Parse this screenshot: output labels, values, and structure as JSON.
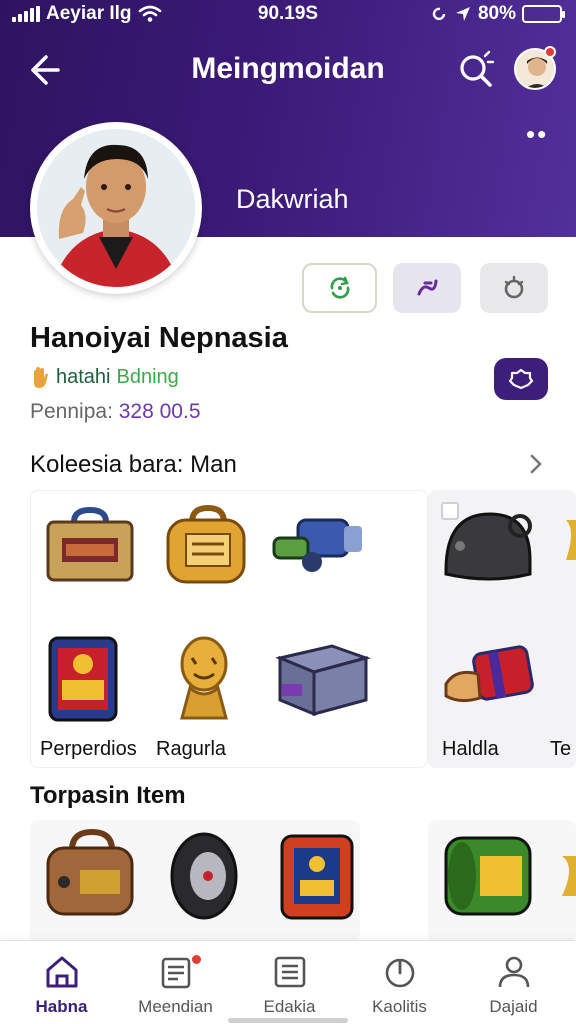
{
  "status_bar": {
    "carrier": "Aeyiar Ilg",
    "time": "90.19S",
    "battery_percent": "80%",
    "battery_level": 0.8
  },
  "header": {
    "title": "Meingmoidan",
    "display_name": "Dakwriah"
  },
  "profile": {
    "name": "Hanoiyai Nepnasia",
    "status_word1": "hatahi",
    "status_word2": "Bdning",
    "points_label": "Pennipa:",
    "points_value": "328 00.5"
  },
  "collection": {
    "title": "Koleesia bara: Man",
    "labels": [
      "Perperdios",
      "Ragurla",
      "Haldla",
      "Te"
    ]
  },
  "top_items": {
    "title": "Torpasin Item"
  },
  "bottom_nav": [
    {
      "label": "Habna",
      "icon": "home-icon",
      "active": true
    },
    {
      "label": "Meendian",
      "icon": "inbox-icon",
      "active": false
    },
    {
      "label": "Edakia",
      "icon": "list-icon",
      "active": false
    },
    {
      "label": "Kaolitis",
      "icon": "power-icon",
      "active": false
    },
    {
      "label": "Dajaid",
      "icon": "person-icon",
      "active": false
    }
  ],
  "colors": {
    "header_purple": "#3b1a78",
    "accent_purple": "#3d1e7a",
    "status_green": "#3bab4a",
    "points_purple": "#6a3aa8"
  }
}
